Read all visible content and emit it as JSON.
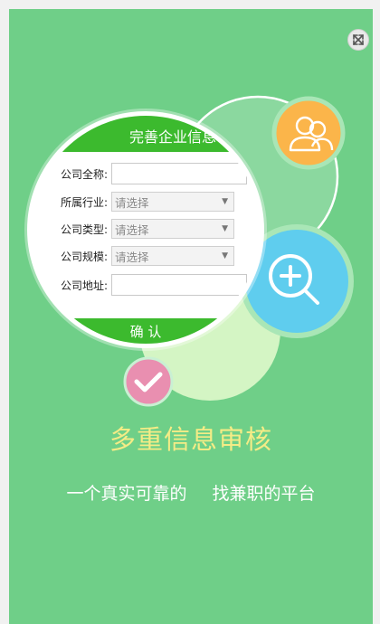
{
  "form": {
    "header": "完善企业信息",
    "fields": [
      {
        "label": "公司全称:",
        "type": "input",
        "value": ""
      },
      {
        "label": "所属行业:",
        "type": "select",
        "placeholder": "请选择"
      },
      {
        "label": "公司类型:",
        "type": "select",
        "placeholder": "请选择"
      },
      {
        "label": "公司规模:",
        "type": "select",
        "placeholder": "请选择"
      },
      {
        "label": "公司地址:",
        "type": "input",
        "value": ""
      }
    ],
    "confirm_label": "确 认"
  },
  "hero": {
    "title": "多重信息审核",
    "subtitle_part1": "一个真实可靠的",
    "subtitle_part2": "找兼职的平台"
  },
  "colors": {
    "background": "#6fcf88",
    "title": "#f4ec86",
    "form_header": "#3cba2e",
    "user_circle": "#fbb54a",
    "search_circle": "#5fcdee",
    "check_circle": "#e98fb0"
  },
  "icons": [
    "expand-icon",
    "user-icon",
    "zoom-in-icon",
    "check-icon"
  ]
}
